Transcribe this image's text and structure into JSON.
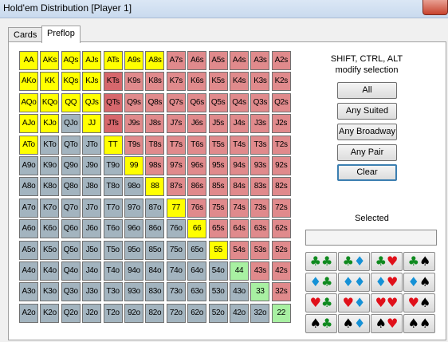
{
  "window": {
    "title": "Hold'em Distribution [Player 1]"
  },
  "tabs": [
    {
      "label": "Cards"
    },
    {
      "label": "Preflop"
    }
  ],
  "colors": {
    "pair_selected": "#ffff00",
    "suited": "#e08a8c",
    "suited_alt": "#d6676c",
    "offsuit": "#a3b4bf",
    "selected_low_pair": "#a8f0a2"
  },
  "grid": {
    "rows": [
      [
        [
          "AA",
          "y"
        ],
        [
          "AKs",
          "y"
        ],
        [
          "AQs",
          "y"
        ],
        [
          "AJs",
          "y"
        ],
        [
          "ATs",
          "y"
        ],
        [
          "A9s",
          "y"
        ],
        [
          "A8s",
          "y"
        ],
        [
          "A7s",
          "r"
        ],
        [
          "A6s",
          "r"
        ],
        [
          "A5s",
          "r"
        ],
        [
          "A4s",
          "r"
        ],
        [
          "A3s",
          "r"
        ],
        [
          "A2s",
          "r"
        ]
      ],
      [
        [
          "AKo",
          "y"
        ],
        [
          "KK",
          "y"
        ],
        [
          "KQs",
          "y"
        ],
        [
          "KJs",
          "y"
        ],
        [
          "KTs",
          "r2"
        ],
        [
          "K9s",
          "r"
        ],
        [
          "K8s",
          "r"
        ],
        [
          "K7s",
          "r"
        ],
        [
          "K6s",
          "r"
        ],
        [
          "K5s",
          "r"
        ],
        [
          "K4s",
          "r"
        ],
        [
          "K3s",
          "r"
        ],
        [
          "K2s",
          "r"
        ]
      ],
      [
        [
          "AQo",
          "y"
        ],
        [
          "KQo",
          "y"
        ],
        [
          "QQ",
          "y"
        ],
        [
          "QJs",
          "y"
        ],
        [
          "QTs",
          "r2"
        ],
        [
          "Q9s",
          "r"
        ],
        [
          "Q8s",
          "r"
        ],
        [
          "Q7s",
          "r"
        ],
        [
          "Q6s",
          "r"
        ],
        [
          "Q5s",
          "r"
        ],
        [
          "Q4s",
          "r"
        ],
        [
          "Q3s",
          "r"
        ],
        [
          "Q2s",
          "r"
        ]
      ],
      [
        [
          "AJo",
          "y"
        ],
        [
          "KJo",
          "y"
        ],
        [
          "QJo",
          "b"
        ],
        [
          "JJ",
          "y"
        ],
        [
          "JTs",
          "r2"
        ],
        [
          "J9s",
          "r"
        ],
        [
          "J8s",
          "r"
        ],
        [
          "J7s",
          "r"
        ],
        [
          "J6s",
          "r"
        ],
        [
          "J5s",
          "r"
        ],
        [
          "J4s",
          "r"
        ],
        [
          "J3s",
          "r"
        ],
        [
          "J2s",
          "r"
        ]
      ],
      [
        [
          "ATo",
          "y"
        ],
        [
          "KTo",
          "b"
        ],
        [
          "QTo",
          "b"
        ],
        [
          "JTo",
          "b"
        ],
        [
          "TT",
          "y"
        ],
        [
          "T9s",
          "r"
        ],
        [
          "T8s",
          "r"
        ],
        [
          "T7s",
          "r"
        ],
        [
          "T6s",
          "r"
        ],
        [
          "T5s",
          "r"
        ],
        [
          "T4s",
          "r"
        ],
        [
          "T3s",
          "r"
        ],
        [
          "T2s",
          "r"
        ]
      ],
      [
        [
          "A9o",
          "b"
        ],
        [
          "K9o",
          "b"
        ],
        [
          "Q9o",
          "b"
        ],
        [
          "J9o",
          "b"
        ],
        [
          "T9o",
          "b"
        ],
        [
          "99",
          "y"
        ],
        [
          "98s",
          "r"
        ],
        [
          "97s",
          "r"
        ],
        [
          "96s",
          "r"
        ],
        [
          "95s",
          "r"
        ],
        [
          "94s",
          "r"
        ],
        [
          "93s",
          "r"
        ],
        [
          "92s",
          "r"
        ]
      ],
      [
        [
          "A8o",
          "b"
        ],
        [
          "K8o",
          "b"
        ],
        [
          "Q8o",
          "b"
        ],
        [
          "J8o",
          "b"
        ],
        [
          "T8o",
          "b"
        ],
        [
          "98o",
          "b"
        ],
        [
          "88",
          "y"
        ],
        [
          "87s",
          "r"
        ],
        [
          "86s",
          "r"
        ],
        [
          "85s",
          "r"
        ],
        [
          "84s",
          "r"
        ],
        [
          "83s",
          "r"
        ],
        [
          "82s",
          "r"
        ]
      ],
      [
        [
          "A7o",
          "b"
        ],
        [
          "K7o",
          "b"
        ],
        [
          "Q7o",
          "b"
        ],
        [
          "J7o",
          "b"
        ],
        [
          "T7o",
          "b"
        ],
        [
          "97o",
          "b"
        ],
        [
          "87o",
          "b"
        ],
        [
          "77",
          "y"
        ],
        [
          "76s",
          "r"
        ],
        [
          "75s",
          "r"
        ],
        [
          "74s",
          "r"
        ],
        [
          "73s",
          "r"
        ],
        [
          "72s",
          "r"
        ]
      ],
      [
        [
          "A6o",
          "b"
        ],
        [
          "K6o",
          "b"
        ],
        [
          "Q6o",
          "b"
        ],
        [
          "J6o",
          "b"
        ],
        [
          "T6o",
          "b"
        ],
        [
          "96o",
          "b"
        ],
        [
          "86o",
          "b"
        ],
        [
          "76o",
          "b"
        ],
        [
          "66",
          "y"
        ],
        [
          "65s",
          "r"
        ],
        [
          "64s",
          "r"
        ],
        [
          "63s",
          "r"
        ],
        [
          "62s",
          "r"
        ]
      ],
      [
        [
          "A5o",
          "b"
        ],
        [
          "K5o",
          "b"
        ],
        [
          "Q5o",
          "b"
        ],
        [
          "J5o",
          "b"
        ],
        [
          "T5o",
          "b"
        ],
        [
          "95o",
          "b"
        ],
        [
          "85o",
          "b"
        ],
        [
          "75o",
          "b"
        ],
        [
          "65o",
          "b"
        ],
        [
          "55",
          "y"
        ],
        [
          "54s",
          "r"
        ],
        [
          "53s",
          "r"
        ],
        [
          "52s",
          "r"
        ]
      ],
      [
        [
          "A4o",
          "b"
        ],
        [
          "K4o",
          "b"
        ],
        [
          "Q4o",
          "b"
        ],
        [
          "J4o",
          "b"
        ],
        [
          "T4o",
          "b"
        ],
        [
          "94o",
          "b"
        ],
        [
          "84o",
          "b"
        ],
        [
          "74o",
          "b"
        ],
        [
          "64o",
          "b"
        ],
        [
          "54o",
          "b"
        ],
        [
          "44",
          "g"
        ],
        [
          "43s",
          "r"
        ],
        [
          "42s",
          "r"
        ]
      ],
      [
        [
          "A3o",
          "b"
        ],
        [
          "K3o",
          "b"
        ],
        [
          "Q3o",
          "b"
        ],
        [
          "J3o",
          "b"
        ],
        [
          "T3o",
          "b"
        ],
        [
          "93o",
          "b"
        ],
        [
          "83o",
          "b"
        ],
        [
          "73o",
          "b"
        ],
        [
          "63o",
          "b"
        ],
        [
          "53o",
          "b"
        ],
        [
          "43o",
          "b"
        ],
        [
          "33",
          "g"
        ],
        [
          "32s",
          "r"
        ]
      ],
      [
        [
          "A2o",
          "b"
        ],
        [
          "K2o",
          "b"
        ],
        [
          "Q2o",
          "b"
        ],
        [
          "J2o",
          "b"
        ],
        [
          "T2o",
          "b"
        ],
        [
          "92o",
          "b"
        ],
        [
          "82o",
          "b"
        ],
        [
          "72o",
          "b"
        ],
        [
          "62o",
          "b"
        ],
        [
          "52o",
          "b"
        ],
        [
          "42o",
          "b"
        ],
        [
          "32o",
          "b"
        ],
        [
          "22",
          "g"
        ]
      ]
    ]
  },
  "hint": {
    "line1": "SHIFT, CTRL, ALT",
    "line2": "modify selection"
  },
  "buttons": {
    "all": "All",
    "any_suited": "Any Suited",
    "any_broadway": "Any Broadway",
    "any_pair": "Any Pair",
    "clear": "Clear"
  },
  "selected": {
    "label": "Selected",
    "value": ""
  },
  "suit_grid": [
    [
      [
        "club",
        "club"
      ],
      [
        "club",
        "diamond"
      ],
      [
        "club",
        "heart"
      ],
      [
        "club",
        "spade"
      ]
    ],
    [
      [
        "diamond",
        "club"
      ],
      [
        "diamond",
        "diamond"
      ],
      [
        "diamond",
        "heart"
      ],
      [
        "diamond",
        "spade"
      ]
    ],
    [
      [
        "heart",
        "club"
      ],
      [
        "heart",
        "diamond"
      ],
      [
        "heart",
        "heart"
      ],
      [
        "heart",
        "spade"
      ]
    ],
    [
      [
        "spade",
        "club"
      ],
      [
        "spade",
        "diamond"
      ],
      [
        "spade",
        "heart"
      ],
      [
        "spade",
        "spade"
      ]
    ]
  ],
  "suit_style": {
    "club": {
      "glyph": "♣",
      "color": "#0f8a1f"
    },
    "diamond": {
      "glyph": "♦",
      "color": "#1591d6"
    },
    "heart": {
      "glyph": "♥",
      "color": "#e0101a"
    },
    "spade": {
      "glyph": "♠",
      "color": "#000000"
    }
  }
}
